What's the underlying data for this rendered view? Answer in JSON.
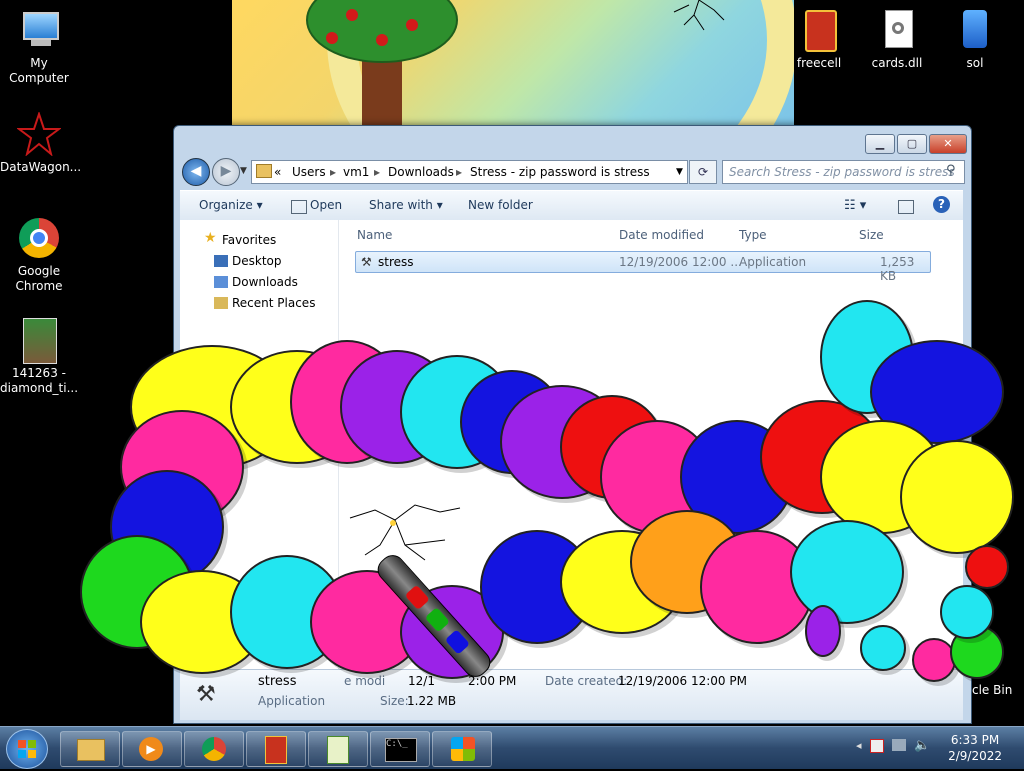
{
  "desktop": {
    "icons_left": [
      {
        "label": "My Computer"
      },
      {
        "label": "DataWagon..."
      },
      {
        "label": "Google Chrome"
      },
      {
        "label": "141263 - diamond_ti..."
      }
    ],
    "icons_top": [
      {
        "label": "freecell"
      },
      {
        "label": "cards.dll"
      },
      {
        "label": "sol"
      }
    ],
    "recycle_bin_label": "cle Bin"
  },
  "explorer": {
    "breadcrumb": {
      "prefix": "«",
      "parts": [
        "Users",
        "vm1",
        "Downloads",
        "Stress - zip password is stress"
      ]
    },
    "search_placeholder": "Search Stress - zip password is stress",
    "toolbar": {
      "organize": "Organize",
      "open": "Open",
      "share_with": "Share with",
      "new_folder": "New folder"
    },
    "nav": {
      "favorites": "Favorites",
      "items": [
        "Desktop",
        "Downloads",
        "Recent Places"
      ]
    },
    "columns": {
      "name": "Name",
      "date_modified": "Date modified",
      "type": "Type",
      "size": "Size"
    },
    "file": {
      "name": "stress",
      "date_modified": "12/19/2006 12:00 ...",
      "type": "Application",
      "size": "1,253 KB"
    },
    "details": {
      "name": "stress",
      "type": "Application",
      "modified_label": "e modi",
      "modified_value": "12/1",
      "modified_time": "2:00 PM",
      "created_label": "Date created:",
      "created_value": "12/19/2006 12:00 PM",
      "size_label": "Size:",
      "size_value": "1.22 MB"
    }
  },
  "taskbar": {
    "time": "6:33 PM",
    "date": "2/9/2022"
  },
  "colors": {
    "blob_yellow": "#ffff1a",
    "blob_pink": "#ff2aa0",
    "blob_cyan": "#22e6f0",
    "blob_purple": "#9b22e8",
    "blob_blue": "#1414e0",
    "blob_red": "#ee1010",
    "blob_orange": "#ffa01a",
    "blob_green": "#1ed81e"
  }
}
